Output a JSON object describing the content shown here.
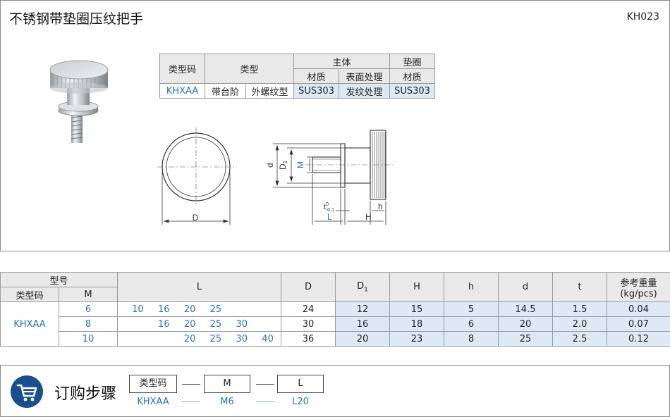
{
  "header": {
    "title": "不锈钢带垫圈压纹把手",
    "code": "KH023"
  },
  "type_table": {
    "col_type_code": "类型码",
    "col_type": "类型",
    "col_main": "主体",
    "col_washer": "垫圈",
    "col_material": "材质",
    "col_surface": "表面处理",
    "col_washer_material": "材质",
    "row": {
      "type_code": "KHXAA",
      "type_a": "带台阶",
      "type_b": "外螺纹型",
      "material": "SUS303",
      "surface": "发纹处理",
      "washer_material": "SUS303"
    }
  },
  "drawing_labels": {
    "D": "D",
    "d": "d",
    "D1_main": "D",
    "D1_sub": "1",
    "M": "M",
    "t_main": "t",
    "t_sup": "0",
    "t_sub": "-0.1",
    "L": "L",
    "H": "H",
    "h": "h"
  },
  "spec_table": {
    "h_model": "型号",
    "h_type_code": "类型码",
    "h_M": "M",
    "h_L": "L",
    "h_D": "D",
    "h_D1_main": "D",
    "h_D1_sub": "1",
    "h_H": "H",
    "h_h": "h",
    "h_d": "d",
    "h_t": "t",
    "h_weight_1": "参考重量",
    "h_weight_2": "(kg/pcs)",
    "type_code": "KHXAA",
    "rows": [
      {
        "M": "6",
        "L": [
          "10",
          "16",
          "20",
          "25",
          "",
          ""
        ],
        "D": "24",
        "D1": "12",
        "H": "15",
        "h": "5",
        "d": "14.5",
        "t": "1.5",
        "weight": "0.04"
      },
      {
        "M": "8",
        "L": [
          "",
          "16",
          "20",
          "25",
          "30",
          ""
        ],
        "D": "30",
        "D1": "16",
        "H": "18",
        "h": "6",
        "d": "20",
        "t": "2.0",
        "weight": "0.07"
      },
      {
        "M": "10",
        "L": [
          "",
          "",
          "20",
          "25",
          "30",
          "40"
        ],
        "D": "36",
        "D1": "20",
        "H": "23",
        "h": "8",
        "d": "25",
        "t": "2.5",
        "weight": "0.12"
      }
    ]
  },
  "order": {
    "title": "订购步骤",
    "box1": "类型码",
    "box2": "M",
    "box3": "L",
    "val1": "KHXAA",
    "val2": "M6",
    "val3": "L20"
  },
  "colors": {
    "blue_text": "#2874b8",
    "header_bg": "#e9e9e9",
    "data_bg": "#ddeaf6",
    "cart_bg": "#1a4f8f"
  }
}
